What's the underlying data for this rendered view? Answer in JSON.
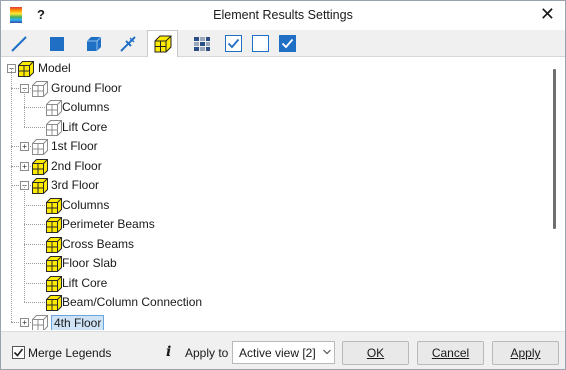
{
  "window": {
    "title": "Element Results Settings",
    "help": "?",
    "close": "✕"
  },
  "toolbar": {
    "tabs": [
      {
        "name": "line-elements-tab",
        "icon": "line-icon"
      },
      {
        "name": "shell-elements-tab",
        "icon": "square-icon"
      },
      {
        "name": "solid-elements-tab",
        "icon": "solid-cube-icon"
      },
      {
        "name": "links-tab",
        "icon": "link-icon"
      },
      {
        "name": "groups-tab",
        "icon": "group-cube-icon",
        "active": true
      },
      {
        "name": "layout-tab",
        "icon": "grid-icon"
      }
    ],
    "checkboxes": [
      {
        "name": "check-all-button",
        "icon": "checkbox-checked-icon"
      },
      {
        "name": "uncheck-all-button",
        "icon": "checkbox-empty-icon"
      },
      {
        "name": "check-selected-button",
        "icon": "checkbox-filled-icon"
      }
    ]
  },
  "tree": {
    "items": [
      {
        "label": "Model",
        "level": 0,
        "expander": "−",
        "icon": "yellow"
      },
      {
        "label": "Ground Floor",
        "level": 1,
        "expander": "−",
        "icon": "white"
      },
      {
        "label": "Columns",
        "level": 2,
        "icon": "white"
      },
      {
        "label": "Lift Core",
        "level": 2,
        "icon": "white"
      },
      {
        "label": "1st Floor",
        "level": 1,
        "expander": "+",
        "icon": "white"
      },
      {
        "label": "2nd Floor",
        "level": 1,
        "expander": "+",
        "icon": "yellow"
      },
      {
        "label": "3rd Floor",
        "level": 1,
        "expander": "−",
        "icon": "yellow"
      },
      {
        "label": "Columns",
        "level": 2,
        "icon": "yellow"
      },
      {
        "label": "Perimeter Beams",
        "level": 2,
        "icon": "yellow"
      },
      {
        "label": "Cross Beams",
        "level": 2,
        "icon": "yellow"
      },
      {
        "label": "Floor Slab",
        "level": 2,
        "icon": "yellow"
      },
      {
        "label": "Lift Core",
        "level": 2,
        "icon": "yellow"
      },
      {
        "label": "Beam/Column Connection",
        "level": 2,
        "icon": "yellow"
      },
      {
        "label": "4th Floor",
        "level": 1,
        "expander": "+",
        "icon": "white",
        "selected": true
      }
    ]
  },
  "footer": {
    "merge_legends": "Merge Legends",
    "merge_checked": true,
    "info": "i",
    "apply_to": "Apply to",
    "apply_to_value": "Active view [2]",
    "ok": "OK",
    "cancel": "Cancel",
    "apply": "Apply"
  },
  "colors": {
    "accent": "#1f6fc5",
    "yellow_icon": "#ffeb00",
    "selection": "#cfe3f7"
  }
}
